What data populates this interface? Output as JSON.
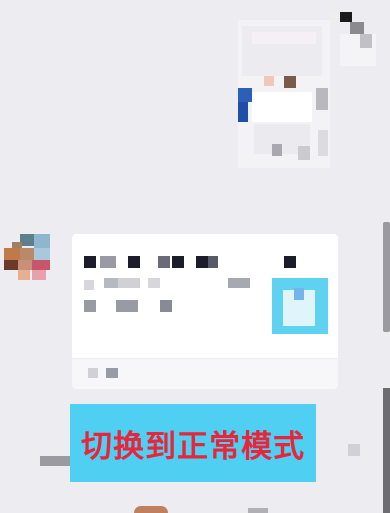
{
  "chat": {
    "switch_button_label": "切换到正常模式"
  },
  "colors": {
    "background": "#ececf1",
    "card": "#ffffff",
    "button_bg": "#4fd0f3",
    "button_text": "#e8253a",
    "thumb": "#5ed2f0"
  },
  "icons": {
    "sticker": "pixelated-sticker-icon",
    "avatar": "user-avatar-icon",
    "link_thumb": "link-thumbnail-icon"
  }
}
